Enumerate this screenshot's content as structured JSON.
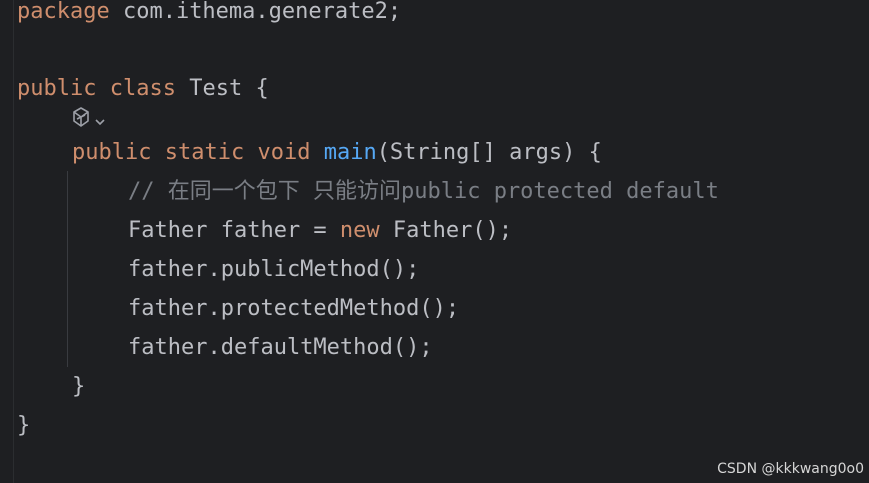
{
  "code": {
    "line1": {
      "kw": "package",
      "rest": " com.ithema.generate2;"
    },
    "line2": {
      "kw1": "public",
      "kw2": "class",
      "rest": " Test {"
    },
    "line3": {
      "kw1": "public",
      "kw2": "static",
      "kw3": "void",
      "fn": "main",
      "rest": "(String[] args) {"
    },
    "line4": {
      "comment": "// 在同一个包下 只能访问public protected default"
    },
    "line5": {
      "pre": "Father father = ",
      "kw": "new",
      "post": " Father();"
    },
    "line6": {
      "text": "father.publicMethod();"
    },
    "line7": {
      "text": "father.protectedMethod();"
    },
    "line8": {
      "text": "father.defaultMethod();"
    },
    "line9": {
      "text": "}"
    },
    "line10": {
      "text": "}"
    }
  },
  "icons": {
    "inline_hint": "ai-assistant-icon",
    "dropdown": "chevron-down-icon"
  },
  "watermark": "CSDN @kkkwang0o0",
  "colors": {
    "background": "#1e1f22",
    "keyword": "#cf8e6d",
    "function": "#56a8f5",
    "comment": "#7a7e85",
    "text": "#bcbec4"
  }
}
